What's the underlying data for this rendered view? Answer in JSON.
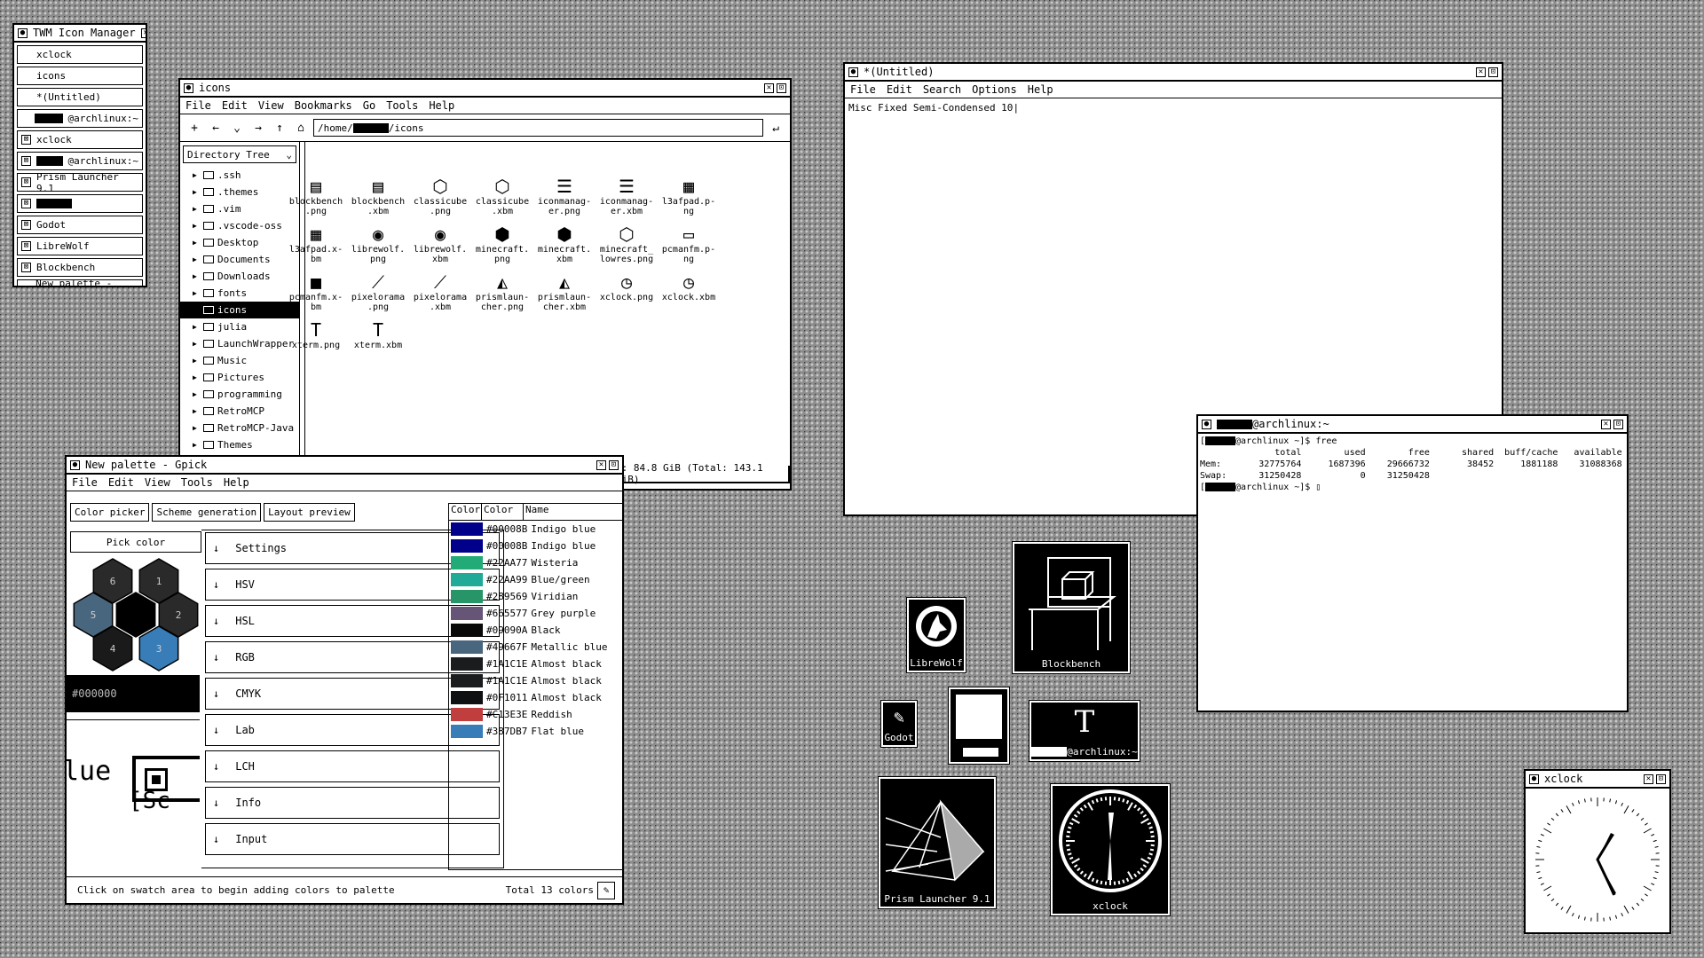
{
  "icon_manager": {
    "title": "TWM Icon Manager",
    "items": [
      {
        "label": "xclock",
        "iconified": false,
        "redact": false
      },
      {
        "label": "icons",
        "iconified": false,
        "redact": false
      },
      {
        "label": "*(Untitled)",
        "iconified": false,
        "redact": false
      },
      {
        "label": "@archlinux:~",
        "iconified": false,
        "redact": true
      },
      {
        "label": "xclock",
        "iconified": true,
        "redact": false
      },
      {
        "label": "@archlinux:~",
        "iconified": true,
        "redact": true
      },
      {
        "label": "Prism Launcher 9.1",
        "iconified": true,
        "redact": false
      },
      {
        "label": "",
        "iconified": true,
        "redact": true
      },
      {
        "label": "Godot",
        "iconified": true,
        "redact": false
      },
      {
        "label": "LibreWolf",
        "iconified": true,
        "redact": false
      },
      {
        "label": "Blockbench",
        "iconified": true,
        "redact": false
      },
      {
        "label": "New palette - Gpick",
        "iconified": false,
        "redact": false
      }
    ]
  },
  "file_manager": {
    "title": "icons",
    "menu": [
      "File",
      "Edit",
      "View",
      "Bookmarks",
      "Go",
      "Tools",
      "Help"
    ],
    "toolbar": {
      "add": "+",
      "back": "←",
      "down": "⌄",
      "forward": "→",
      "up": "↑",
      "home": "⌂",
      "go": "↵"
    },
    "path_prefix": "/home/",
    "path_suffix": "/icons",
    "tree_mode": "Directory Tree",
    "tree": [
      {
        "label": ".ssh",
        "selected": false
      },
      {
        "label": ".themes",
        "selected": false
      },
      {
        "label": ".vim",
        "selected": false
      },
      {
        "label": ".vscode-oss",
        "selected": false
      },
      {
        "label": "Desktop",
        "selected": false
      },
      {
        "label": "Documents",
        "selected": false
      },
      {
        "label": "Downloads",
        "selected": false
      },
      {
        "label": "fonts",
        "selected": false
      },
      {
        "label": "icons",
        "selected": true
      },
      {
        "label": "julia",
        "selected": false
      },
      {
        "label": "LaunchWrapper",
        "selected": false
      },
      {
        "label": "Music",
        "selected": false
      },
      {
        "label": "Pictures",
        "selected": false
      },
      {
        "label": "programming",
        "selected": false
      },
      {
        "label": "RetroMCP",
        "selected": false
      },
      {
        "label": "RetroMCP-Java",
        "selected": false
      },
      {
        "label": "Themes",
        "selected": false
      }
    ],
    "files": [
      {
        "name": "blockbench\n.png",
        "glyph": "▤"
      },
      {
        "name": "blockbench\n.xbm",
        "glyph": "▤"
      },
      {
        "name": "classicube\n.png",
        "glyph": "⬡"
      },
      {
        "name": "classicube\n.xbm",
        "glyph": "⬡"
      },
      {
        "name": "iconmanag-\ner.png",
        "glyph": "☰"
      },
      {
        "name": "iconmanag-\ner.xbm",
        "glyph": "☰"
      },
      {
        "name": "l3afpad.p-\nng",
        "glyph": "▦"
      },
      {
        "name": "l3afpad.x-\nbm",
        "glyph": "▦"
      },
      {
        "name": "librewolf.\npng",
        "glyph": "◉"
      },
      {
        "name": "librewolf.\nxbm",
        "glyph": "◉"
      },
      {
        "name": "minecraft.\npng",
        "glyph": "⬢"
      },
      {
        "name": "minecraft.\nxbm",
        "glyph": "⬢"
      },
      {
        "name": "minecraft_\nlowres.png",
        "glyph": "⬡"
      },
      {
        "name": "pcmanfm.p-\nng",
        "glyph": "▭"
      },
      {
        "name": "pcmanfm.x-\nbm",
        "glyph": "■"
      },
      {
        "name": "pixelorama\n.png",
        "glyph": "⟋"
      },
      {
        "name": "pixelorama\n.xbm",
        "glyph": "⟋"
      },
      {
        "name": "prismlaun-\ncher.png",
        "glyph": "◭"
      },
      {
        "name": "prismlaun-\ncher.xbm",
        "glyph": "◭"
      },
      {
        "name": "xclock.png",
        "glyph": "◷"
      },
      {
        "name": "xclock.xbm",
        "glyph": "◷"
      },
      {
        "name": "xterm.png",
        "glyph": "T"
      },
      {
        "name": "xterm.xbm",
        "glyph": "T"
      }
    ],
    "status": "e: 84.8 GiB (Total: 143.1 GiB)"
  },
  "editor": {
    "title": "*(Untitled)",
    "menu": [
      "File",
      "Edit",
      "Search",
      "Options",
      "Help"
    ],
    "content": "Misc Fixed Semi-Condensed 10"
  },
  "terminal": {
    "title_suffix": "@archlinux:~",
    "lines": [
      {
        "prompt": true,
        "text": "@archlinux ~]$ free"
      },
      {
        "prompt": false,
        "text": "              total        used        free      shared  buff/cache   available"
      },
      {
        "prompt": false,
        "text": "Mem:       32775764     1687396    29666732       38452     1881188    31088368"
      },
      {
        "prompt": false,
        "text": "Swap:      31250428           0    31250428"
      },
      {
        "prompt": true,
        "text": "@archlinux ~]$ ▯"
      }
    ]
  },
  "gpick": {
    "title": "New palette - Gpick",
    "menu": [
      "File",
      "Edit",
      "View",
      "Tools",
      "Help"
    ],
    "tabs": [
      "Color picker",
      "Scheme generation",
      "Layout preview"
    ],
    "pick_label": "Pick color",
    "hex_value": "#000000",
    "hexagons": [
      {
        "n": "6",
        "color": "#2a2a2a"
      },
      {
        "n": "1",
        "color": "#2a2a2a"
      },
      {
        "n": "5",
        "color": "#49667F"
      },
      {
        "n": "",
        "color": "#000000"
      },
      {
        "n": "2",
        "color": "#2a2a2a"
      },
      {
        "n": "4",
        "color": "#1a1a1a"
      },
      {
        "n": "3",
        "color": "#387DB7"
      }
    ],
    "zoom_text": "lue",
    "zoom_text2": "[Sc",
    "sections": [
      "Settings",
      "HSV",
      "HSL",
      "RGB",
      "CMYK",
      "Lab",
      "LCH",
      "Info",
      "Input"
    ],
    "palette_headers": [
      "Color",
      "Color",
      "Name"
    ],
    "palette": [
      {
        "hex": "#00008B",
        "name": "Indigo blue",
        "color": "#00008B"
      },
      {
        "hex": "#00008B",
        "name": "Indigo blue",
        "color": "#00008B"
      },
      {
        "hex": "#22AA77",
        "name": "Wisteria",
        "color": "#22AA77"
      },
      {
        "hex": "#22AA99",
        "name": "Blue/green",
        "color": "#22AA99"
      },
      {
        "hex": "#289569",
        "name": "Viridian",
        "color": "#289569"
      },
      {
        "hex": "#665577",
        "name": "Grey purple",
        "color": "#665577"
      },
      {
        "hex": "#09090A",
        "name": "Black",
        "color": "#09090A"
      },
      {
        "hex": "#49667F",
        "name": "Metallic blue",
        "color": "#49667F"
      },
      {
        "hex": "#1A1C1E",
        "name": "Almost black",
        "color": "#1A1C1E"
      },
      {
        "hex": "#1A1C1E",
        "name": "Almost black",
        "color": "#1A1C1E"
      },
      {
        "hex": "#0F1011",
        "name": "Almost black",
        "color": "#0F1011"
      },
      {
        "hex": "#C13E3E",
        "name": "Reddish",
        "color": "#C13E3E"
      },
      {
        "hex": "#387DB7",
        "name": "Flat blue",
        "color": "#387DB7"
      }
    ],
    "status_left": "Click on swatch area to begin adding colors to palette",
    "status_right": "Total 13 colors"
  },
  "desktop_icons": {
    "librewolf": "LibreWolf",
    "blockbench": "Blockbench",
    "godot": "Godot",
    "terminal": "@archlinux:~",
    "prism": "Prism Launcher 9.1",
    "xclock": "xclock"
  },
  "xclock": {
    "title": "xclock"
  }
}
